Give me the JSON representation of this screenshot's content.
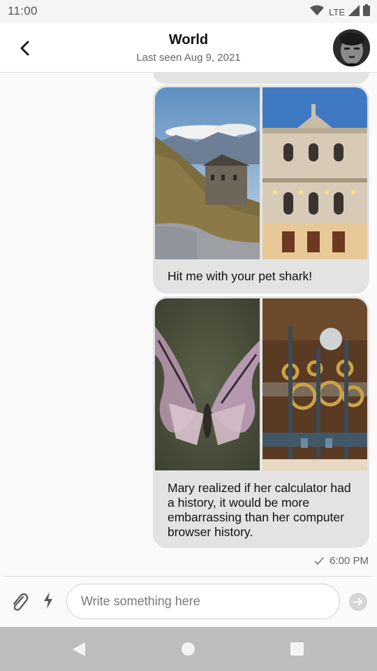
{
  "status_bar": {
    "time": "11:00",
    "network": "LTE",
    "icons": [
      "wifi-icon",
      "cell-signal-icon",
      "battery-icon"
    ]
  },
  "header": {
    "title": "World",
    "subtitle": "Last seen Aug 9, 2021",
    "back_icon": "chevron-left-icon",
    "avatar": "contact-avatar"
  },
  "messages": [
    {
      "images": [
        "mountain-stone-house-photo",
        "illuminated-theatre-facade-photo"
      ],
      "text": "Hit me with your pet shark!"
    },
    {
      "images": [
        "butterfly-photo",
        "clockwork-gears-photo"
      ],
      "text": "Mary realized if her calculator had a history, it would be more embarrassing than her computer browser history."
    }
  ],
  "last_message_meta": {
    "status_icon": "check-icon",
    "time": "6:00 PM"
  },
  "composer": {
    "placeholder": "Write something here",
    "value": "",
    "attach_icon": "paperclip-icon",
    "quick_icon": "lightning-icon",
    "send_icon": "send-arrow-icon"
  },
  "navigation_bar": {
    "buttons": [
      "nav-back-icon",
      "nav-home-icon",
      "nav-recents-icon"
    ]
  },
  "colors": {
    "bubble": "#e3e3e3",
    "background": "#fafafa",
    "nav_bar": "#bdbdbd"
  }
}
